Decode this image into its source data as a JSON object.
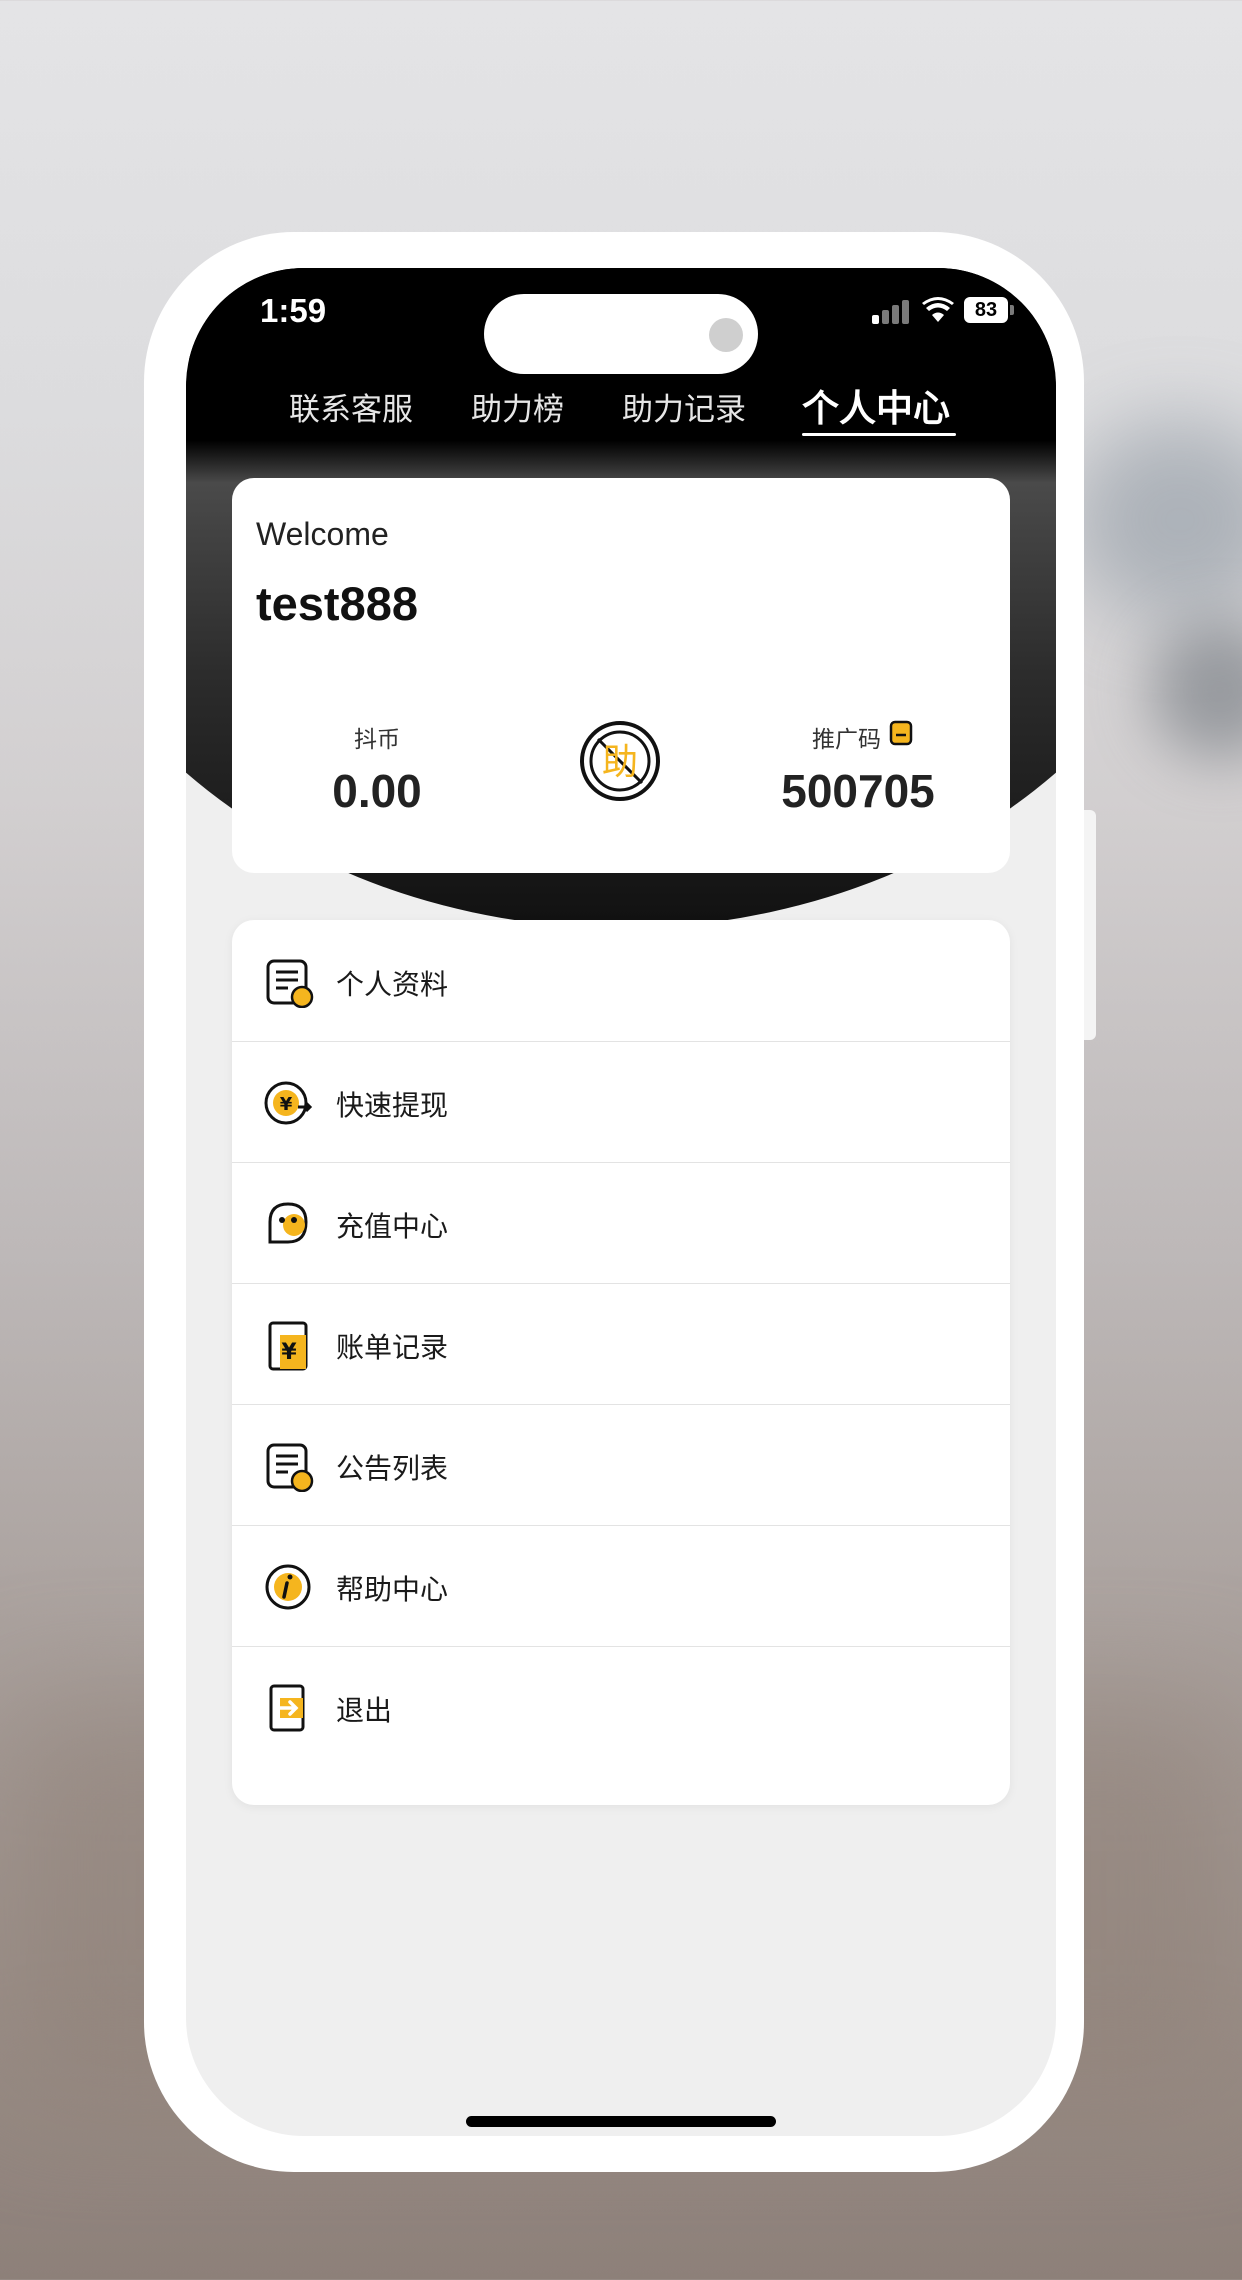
{
  "status_bar": {
    "time": "1:59",
    "battery": "83"
  },
  "nav": {
    "tabs": [
      {
        "label": "联系客服",
        "active": false
      },
      {
        "label": "助力榜",
        "active": false
      },
      {
        "label": "助力记录",
        "active": false
      },
      {
        "label": "个人中心",
        "active": true
      }
    ]
  },
  "profile": {
    "welcome": "Welcome",
    "username": "test888",
    "coin_label": "抖币",
    "coin_value": "0.00",
    "badge_char": "助",
    "promo_label": "推广码",
    "promo_code": "500705"
  },
  "menu": {
    "items": [
      {
        "label": "个人资料",
        "icon": "profile-doc-icon"
      },
      {
        "label": "快速提现",
        "icon": "withdraw-yen-icon"
      },
      {
        "label": "充值中心",
        "icon": "recharge-icon"
      },
      {
        "label": "账单记录",
        "icon": "bill-yen-icon"
      },
      {
        "label": "公告列表",
        "icon": "announcement-doc-icon"
      },
      {
        "label": "帮助中心",
        "icon": "info-icon"
      },
      {
        "label": "退出",
        "icon": "logout-icon"
      }
    ]
  },
  "colors": {
    "accent": "#f5b51e",
    "header_dark": "#1a1a1a",
    "page_bg": "#efefef"
  }
}
